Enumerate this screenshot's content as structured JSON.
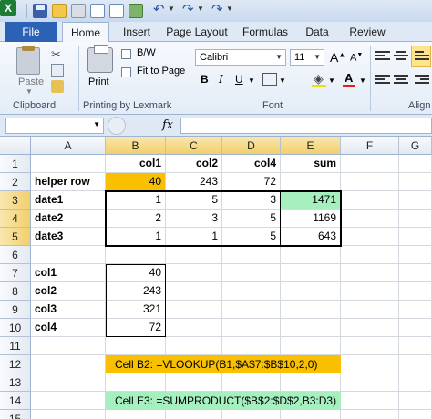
{
  "qat": {
    "app_icon": "excel-icon",
    "icons": [
      "save-icon",
      "open-folder-icon",
      "print-icon",
      "page-icon",
      "page-icon",
      "spreadsheet-icon",
      "undo-icon",
      "redo-icon",
      "redo-icon"
    ]
  },
  "tabs": [
    "File",
    "Home",
    "Insert",
    "Page Layout",
    "Formulas",
    "Data",
    "Review"
  ],
  "ribbon": {
    "clipboard": {
      "paste": "Paste",
      "label": "Clipboard"
    },
    "printing": {
      "print": "Print",
      "bw": "B/W",
      "fit": "Fit to Page",
      "label": "Printing by Lexmark"
    },
    "font": {
      "name": "Calibri",
      "size": "11",
      "grow": "A",
      "shrink": "A",
      "bold": "B",
      "italic": "I",
      "underline": "U",
      "label": "Font"
    },
    "alignment": {
      "label": "Align"
    }
  },
  "formula_bar": {
    "name_box": "",
    "fx": "fx",
    "formula": ""
  },
  "colors": {
    "orange": "#f8c000",
    "green": "#a6f0c0",
    "selected_header": "#f2cf6b"
  },
  "sheet": {
    "columns": [
      "A",
      "B",
      "C",
      "D",
      "E",
      "F",
      "G"
    ],
    "rows": [
      "1",
      "2",
      "3",
      "4",
      "5",
      "6",
      "7",
      "8",
      "9",
      "10",
      "11",
      "12",
      "13",
      "14",
      "15"
    ],
    "cells": {
      "B1": "col1",
      "C1": "col2",
      "D1": "col4",
      "E1": "sum",
      "A2": "helper row",
      "B2": "40",
      "C2": "243",
      "D2": "72",
      "A3": "date1",
      "B3": "1",
      "C3": "5",
      "D3": "3",
      "E3": "1471",
      "A4": "date2",
      "B4": "2",
      "C4": "3",
      "D4": "5",
      "E4": "1169",
      "A5": "date3",
      "B5": "1",
      "C5": "1",
      "D5": "5",
      "E5": "643",
      "A7": "col1",
      "B7": "40",
      "A8": "col2",
      "B8": "243",
      "A9": "col3",
      "B9": "321",
      "A10": "col4",
      "B10": "72"
    },
    "notes": {
      "row12": "Cell B2:  =VLOOKUP(B1,$A$7:$B$10,2,0)",
      "row14": "Cell E3: =SUMPRODUCT($B$2:$D$2,B3:D3)"
    }
  }
}
